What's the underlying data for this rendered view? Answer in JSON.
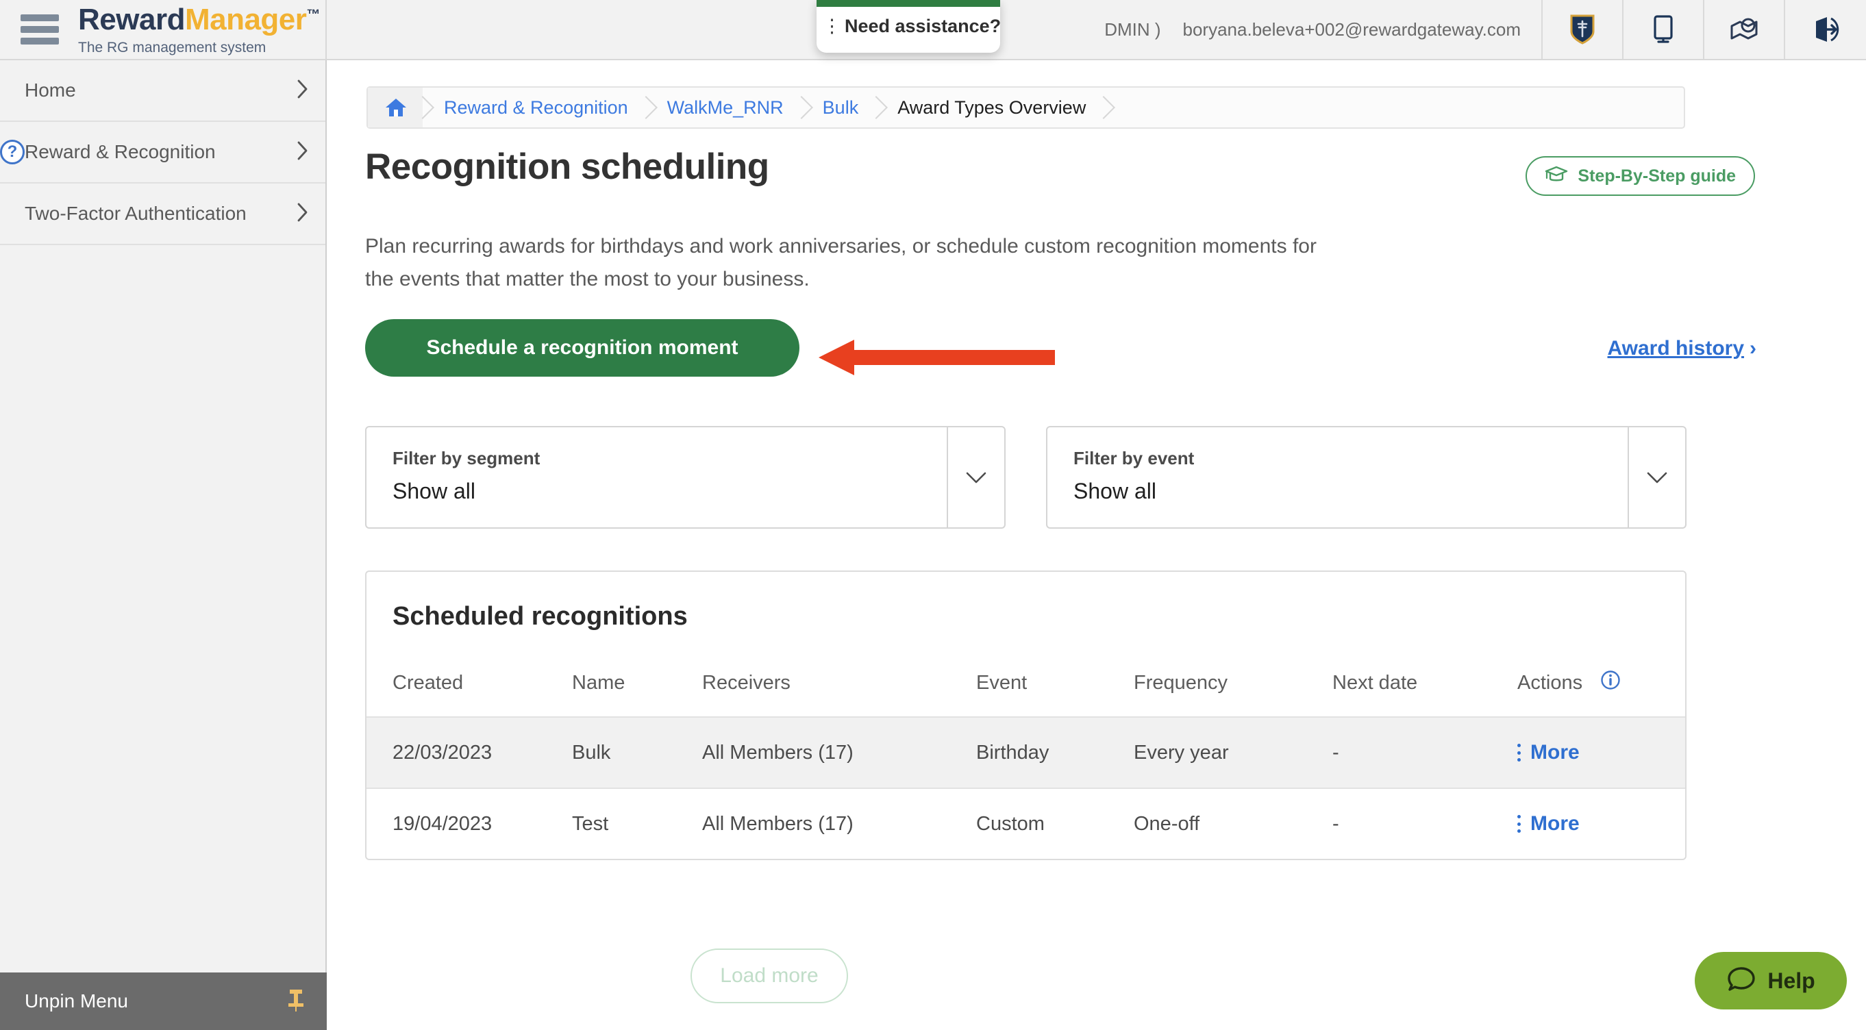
{
  "header": {
    "brand_word1": "Reward",
    "brand_word2": "Manager",
    "brand_tm": "™",
    "brand_subtitle": "The RG management system",
    "admin_text": "DMIN )",
    "user_email": "boryana.beleva+002@rewardgateway.com",
    "icons": [
      "shield-icon",
      "monitor-icon",
      "map-icon",
      "sign-in-icon"
    ]
  },
  "assistance_popup": {
    "dots": "⋮",
    "label": "Need assistance?",
    "chevron": "chevron-down-icon"
  },
  "sidebar": {
    "items": [
      {
        "label": "Home",
        "badge": null
      },
      {
        "label": "Reward & Recognition",
        "badge": "?"
      },
      {
        "label": "Two-Factor Authentication",
        "badge": null
      }
    ],
    "unpin_label": "Unpin Menu",
    "pin_icon": "pin-icon"
  },
  "breadcrumb": {
    "home_icon": "home-icon",
    "items": [
      {
        "label": "Reward & Recognition",
        "current": false
      },
      {
        "label": "WalkMe_RNR",
        "current": false
      },
      {
        "label": "Bulk",
        "current": false
      },
      {
        "label": "Award Types Overview",
        "current": true
      }
    ]
  },
  "page": {
    "title": "Recognition scheduling",
    "guide_button": "Step-By-Step guide",
    "guide_icon": "graduation-cap-icon",
    "description": "Plan recurring awards for birthdays and work anniversaries, or schedule custom recognition moments for the events that matter the most to your business.",
    "cta_label": "Schedule a recognition moment",
    "award_history_label": "Award history",
    "award_history_chevron": "›"
  },
  "filters": [
    {
      "label": "Filter by segment",
      "value": "Show all",
      "chevron": "chevron-down-icon"
    },
    {
      "label": "Filter by event",
      "value": "Show all",
      "chevron": "chevron-down-icon"
    }
  ],
  "table": {
    "title": "Scheduled recognitions",
    "info_icon": "info-icon",
    "columns": [
      "Created",
      "Name",
      "Receivers",
      "Event",
      "Frequency",
      "Next date",
      "Actions"
    ],
    "rows": [
      {
        "created": "22/03/2023",
        "name": "Bulk",
        "receivers": "All Members (17)",
        "event": "Birthday",
        "frequency": "Every year",
        "next_date": "-",
        "action_label": "More"
      },
      {
        "created": "19/04/2023",
        "name": "Test",
        "receivers": "All Members (17)",
        "event": "Custom",
        "frequency": "One-off",
        "next_date": "-",
        "action_label": "More"
      }
    ],
    "load_more_label": "Load more"
  },
  "help_widget": {
    "label": "Help",
    "icon": "chat-bubble-icon"
  },
  "colors": {
    "brand_navy": "#2b3a55",
    "brand_amber": "#f2b233",
    "primary_green": "#2e7d46",
    "link_blue": "#2f6fd0",
    "help_green": "#7cac31",
    "annotation_red": "#e8401f"
  }
}
